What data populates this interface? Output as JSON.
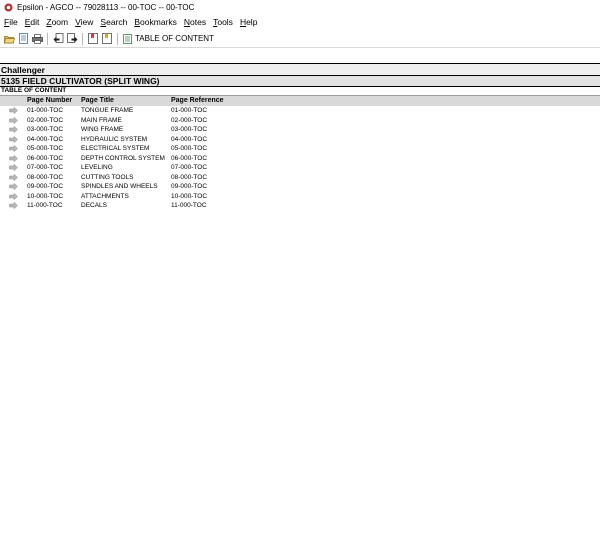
{
  "window": {
    "title": "Epsilon - AGCO -- 79028113 -- 00-TOC -- 00-TOC"
  },
  "menu": [
    {
      "label": "File",
      "u": "F",
      "rest": "ile"
    },
    {
      "label": "Edit",
      "u": "E",
      "rest": "dit"
    },
    {
      "label": "Zoom",
      "u": "Z",
      "rest": "oom"
    },
    {
      "label": "View",
      "u": "V",
      "rest": "iew"
    },
    {
      "label": "Search",
      "u": "S",
      "rest": "earch"
    },
    {
      "label": "Bookmarks",
      "u": "B",
      "rest": "ookmarks"
    },
    {
      "label": "Notes",
      "u": "N",
      "rest": "otes"
    },
    {
      "label": "Tools",
      "u": "T",
      "rest": "ools"
    },
    {
      "label": "Help",
      "u": "H",
      "rest": "elp"
    }
  ],
  "toolbar": {
    "buttons": [
      "open-folder-icon",
      "document-icon",
      "print-icon",
      "back-icon",
      "forward-icon",
      "bookmark-add-icon",
      "bookmark-icon"
    ],
    "toc_label": "TABLE OF CONTENT"
  },
  "doc": {
    "brand": "Challenger",
    "model": "5135 FIELD CULTIVATOR  (SPLIT WING)",
    "section": "TABLE OF CONTENT",
    "columns": {
      "page_number": "Page Number",
      "page_title": "Page Title",
      "page_reference": "Page Reference"
    },
    "rows": [
      {
        "num": "01-000-TOC",
        "title": "TONGUE FRAME",
        "ref": "01-000-TOC"
      },
      {
        "num": "02-000-TOC",
        "title": "MAIN FRAME",
        "ref": "02-000-TOC"
      },
      {
        "num": "03-000-TOC",
        "title": "WING FRAME",
        "ref": "03-000-TOC"
      },
      {
        "num": "04-000-TOC",
        "title": "HYDRAULIC SYSTEM",
        "ref": "04-000-TOC"
      },
      {
        "num": "05-000-TOC",
        "title": "ELECTRICAL SYSTEM",
        "ref": "05-000-TOC"
      },
      {
        "num": "06-000-TOC",
        "title": "DEPTH CONTROL SYSTEM",
        "ref": "06-000-TOC"
      },
      {
        "num": "07-000-TOC",
        "title": "LEVELING",
        "ref": "07-000-TOC"
      },
      {
        "num": "08-000-TOC",
        "title": "CUTTING TOOLS",
        "ref": "08-000-TOC"
      },
      {
        "num": "09-000-TOC",
        "title": "SPINDLES AND WHEELS",
        "ref": "09-000-TOC"
      },
      {
        "num": "10-000-TOC",
        "title": "ATTACHMENTS",
        "ref": "10-000-TOC"
      },
      {
        "num": "11-000-TOC",
        "title": "DECALS",
        "ref": "11-000-TOC"
      }
    ]
  }
}
